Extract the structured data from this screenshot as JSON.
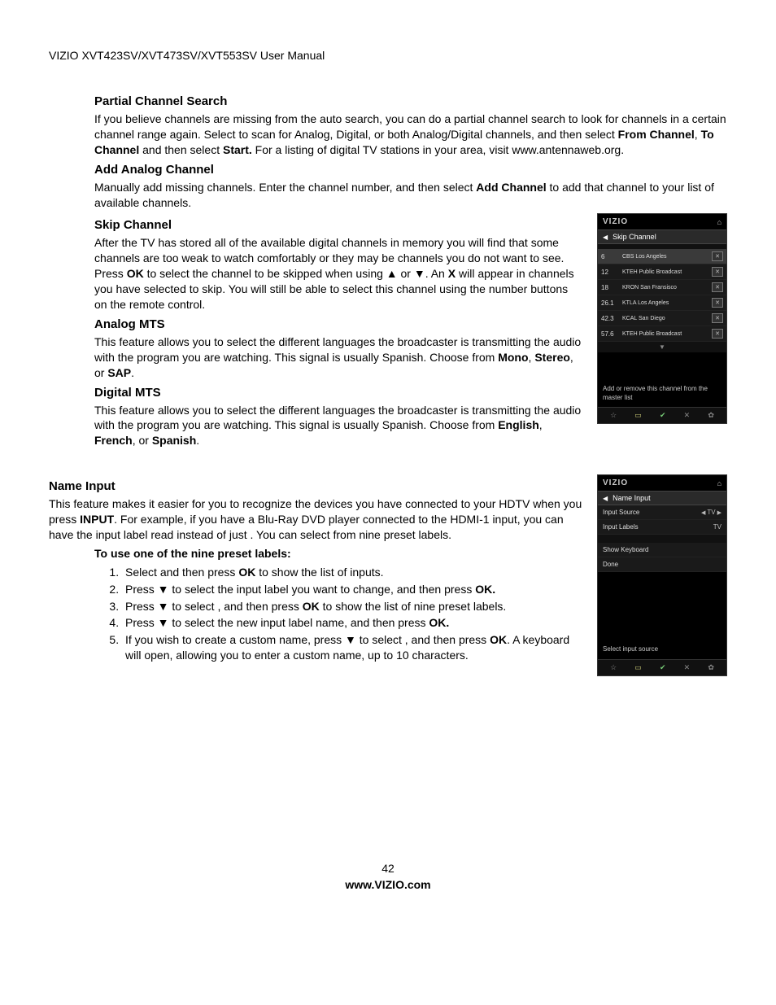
{
  "header": "VIZIO XVT423SV/XVT473SV/XVT553SV User Manual",
  "sections": {
    "partial": {
      "title": "Partial Channel Search",
      "text_before": "If you believe channels are missing from the auto search, you can do a partial channel search to look for channels in a certain channel range again. Select to scan for Analog, Digital, or both Analog/Digital channels, and then select ",
      "b1": "From Channel",
      "mid1": ", ",
      "b2": "To Channel",
      "mid2": " and then select ",
      "b3": "Start.",
      "after": " For a listing of digital TV stations in your area, visit www.antennaweb.org."
    },
    "addanalog": {
      "title": "Add Analog Channel",
      "pre": "Manually add missing channels. Enter the channel number, and then select ",
      "b1": "Add Channel",
      "post": " to add that channel to your list of available channels."
    },
    "skip": {
      "title": "Skip Channel",
      "p1": "After the TV has stored all of the available digital channels in memory you will find that some channels are too weak to watch comfortably or they may be channels you do not want to see. Press ",
      "b_ok": "OK",
      "p2": " to select the channel to be skipped when using ▲ or ▼. An ",
      "b_x": "X",
      "p3": " will appear in channels you have selected to skip. You will still be able to select this channel using the number buttons on the remote control."
    },
    "analogmts": {
      "title": "Analog MTS",
      "pre": "This feature allows you to select the different languages the broadcaster is transmitting the audio with the program you are watching. This signal is usually Spanish. Choose from ",
      "b1": "Mono",
      "m1": ", ",
      "b2": "Stereo",
      "m2": ", or ",
      "b3": "SAP",
      "end": "."
    },
    "digitalmts": {
      "title": "Digital MTS",
      "pre": "This feature allows you to select the different languages the broadcaster is transmitting the audio with the program you are watching. This signal is usually Spanish. Choose from ",
      "b1": "English",
      "m1": ", ",
      "b2": "French",
      "m2": ", or ",
      "b3": "Spanish",
      "end": "."
    },
    "nameinput": {
      "title": "Name Input",
      "pre": " This feature makes it easier for you to recognize the devices you have connected to your HDTV when you press ",
      "b_input": "INPUT",
      "mid": ". For example, if you have a Blu-Ray DVD player connected to the HDMI-1 input, you can have the input label read ",
      "gap1": "                         ",
      "mid2": " instead of just ",
      "gap2": "           ",
      "post": ". You can select from nine preset labels.",
      "subhead": "To use one of the nine preset labels:",
      "steps": {
        "s1a": "Select ",
        "s1gap": "                      ",
        "s1b": " and then press ",
        "s1ok": "OK",
        "s1c": " to show the list of inputs.",
        "s2a": "Press ▼ to select the input label you want to change, and then press ",
        "s2ok": "OK.",
        "s3a": "Press ▼ to select ",
        "s3gap": "                     ",
        "s3b": ", and then press ",
        "s3ok": "OK",
        "s3c": " to show the list of nine preset labels.",
        "s4a": "Press ▼ to select the new input label name, and then press ",
        "s4ok": "OK.",
        "s5a": "If you wish to create a custom name, press ▼ to select ",
        "s5gap": "                          ",
        "s5b": ", and then press ",
        "s5ok": "OK",
        "s5c": ". A keyboard will open, allowing you to enter a custom name, up to 10 characters."
      }
    }
  },
  "tv_skip": {
    "logo": "VIZIO",
    "title": "Skip Channel",
    "channels": [
      {
        "num": "6",
        "name": "CBS Los Angeles"
      },
      {
        "num": "12",
        "name": "KTEH Public Broadcast"
      },
      {
        "num": "18",
        "name": "KRON San Fransisco"
      },
      {
        "num": "26.1",
        "name": "KTLA Los Angeles"
      },
      {
        "num": "42.3",
        "name": "KCAL San Diego"
      },
      {
        "num": "57.6",
        "name": "KTEH Public Broadcast"
      }
    ],
    "hint": "Add or remove this channel from the master list"
  },
  "tv_name": {
    "logo": "VIZIO",
    "title": "Name Input",
    "rows": {
      "input_source_label": "Input Source",
      "input_source_value": "TV",
      "input_labels_label": "Input Labels",
      "input_labels_value": "TV",
      "show_keyboard": "Show Keyboard",
      "done": "Done"
    },
    "hint": "Select input source"
  },
  "footer": {
    "page": "42",
    "url": "www.VIZIO.com"
  }
}
